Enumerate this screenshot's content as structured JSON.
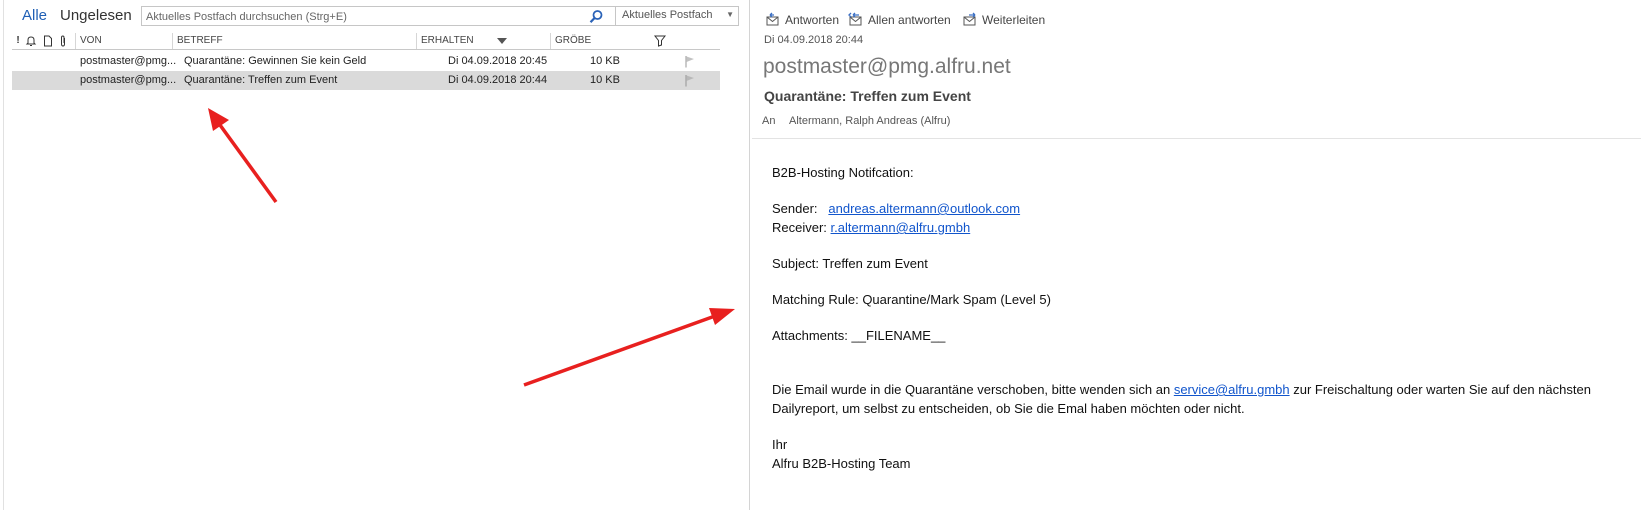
{
  "filters": {
    "all": "Alle",
    "unread": "Ungelesen"
  },
  "search": {
    "placeholder": "Aktuelles Postfach durchsuchen (Strg+E)",
    "scope": "Aktuelles Postfach"
  },
  "columns": {
    "importance": "!",
    "from": "VON",
    "subject": "BETREFF",
    "received": "ERHALTEN",
    "size": "GRÖBE"
  },
  "messages": [
    {
      "from": "postmaster@pmg...",
      "subject": "Quarantäne: Gewinnen Sie kein Geld",
      "received": "Di 04.09.2018 20:45",
      "size": "10 KB"
    },
    {
      "from": "postmaster@pmg...",
      "subject": "Quarantäne: Treffen zum Event",
      "received": "Di 04.09.2018 20:44",
      "size": "10 KB"
    }
  ],
  "reading_pane": {
    "actions": {
      "reply": "Antworten",
      "reply_all": "Allen antworten",
      "forward": "Weiterleiten"
    },
    "date": "Di 04.09.2018 20:44",
    "sender": "postmaster@pmg.alfru.net",
    "subject": "Quarantäne: Treffen zum Event",
    "to_label": "An",
    "to": "Altermann, Ralph Andreas (Alfru)",
    "body": {
      "heading": "B2B-Hosting Notifcation:",
      "sender_label": "Sender:",
      "sender_email": "andreas.altermann@outlook.com",
      "receiver_label": "Receiver:",
      "receiver_email": "r.altermann@alfru.gmbh",
      "subject_line": "Subject:  Treffen zum Event",
      "rule_line": "Matching Rule: Quarantine/Mark Spam (Level 5)",
      "attachments_line": "Attachments: __FILENAME__",
      "para_before": "Die Email wurde in die Quarantäne verschoben, bitte wenden sich an",
      "service_email": "service@alfru.gmbh",
      "para_after": "zur Freischaltung oder warten Sie auf den nächsten",
      "para_line2": "Dailyreport, um selbst zu entscheiden, ob Sie die Emal haben möchten oder nicht.",
      "closing": "Ihr",
      "signature": "Alfru B2B-Hosting Team"
    }
  },
  "colors": {
    "accent": "#1f5fb5",
    "link": "#1155cc",
    "selected_row": "#dadada",
    "arrow": "#e8201f"
  }
}
